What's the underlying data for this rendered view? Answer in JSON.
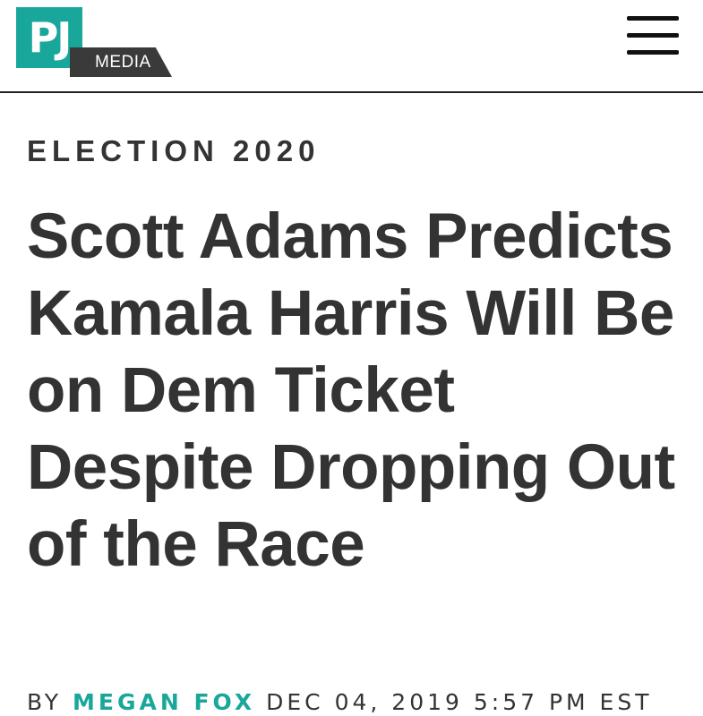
{
  "header": {
    "logo_mark": "PJ",
    "logo_word": "MEDIA",
    "menu_icon": "hamburger-menu-icon"
  },
  "article": {
    "category": "ELECTION 2020",
    "headline": "Scott Adams Predicts Kamala Harris Will Be on Dem Ticket Despite Dropping Out of the Race",
    "byline_prefix": "BY",
    "author": "MEGAN FOX",
    "date": "DEC 04, 2019 5:57 PM EST"
  },
  "colors": {
    "brand_teal": "#1aa79b",
    "text_dark": "#333333",
    "logo_dark": "#3a3a3a"
  }
}
